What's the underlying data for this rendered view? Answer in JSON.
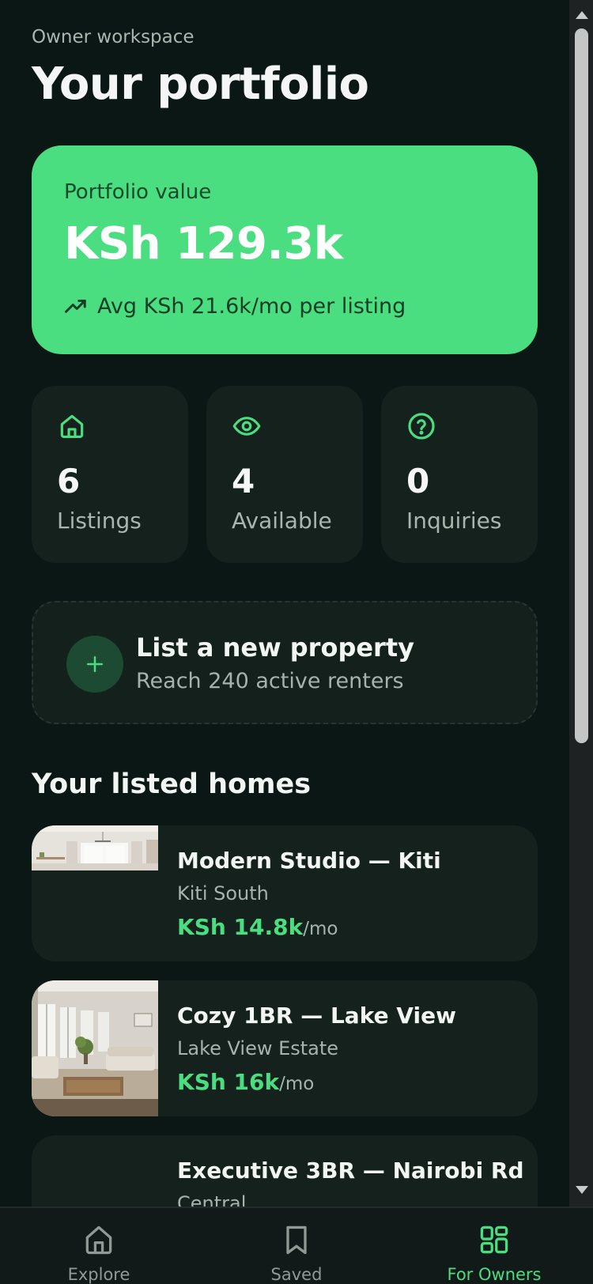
{
  "header": {
    "eyebrow": "Owner workspace",
    "title": "Your portfolio"
  },
  "portfolio": {
    "label": "Portfolio value",
    "value": "KSh 129.3k",
    "avg": "Avg KSh 21.6k/mo per listing",
    "trend_icon": "trending-up-icon"
  },
  "stats": [
    {
      "icon": "home-icon",
      "value": "6",
      "label": "Listings"
    },
    {
      "icon": "eye-icon",
      "value": "4",
      "label": "Available"
    },
    {
      "icon": "help-circle-icon",
      "value": "0",
      "label": "Inquiries"
    }
  ],
  "cta": {
    "icon": "plus-icon",
    "title": "List a new property",
    "subtitle": "Reach 240 active renters"
  },
  "section": {
    "title": "Your listed homes"
  },
  "listings": [
    {
      "name": "Modern Studio — Kiti",
      "location": "Kiti South",
      "price": "KSh 14.8k",
      "per": "/mo"
    },
    {
      "name": "Cozy 1BR — Lake View",
      "location": "Lake View Estate",
      "price": "KSh 16k",
      "per": "/mo"
    },
    {
      "name": "Executive 3BR — Nairobi Rd",
      "location": "Central",
      "price": "",
      "per": ""
    }
  ],
  "tabs": [
    {
      "icon": "home-outline-icon",
      "label": "Explore",
      "active": false
    },
    {
      "icon": "bookmark-icon",
      "label": "Saved",
      "active": false
    },
    {
      "icon": "grid-icon",
      "label": "For Owners",
      "active": true
    }
  ],
  "colors": {
    "background": "#0b1714",
    "card": "#14211d",
    "accent": "#4ade80",
    "muted_text": "#a9b5af"
  }
}
